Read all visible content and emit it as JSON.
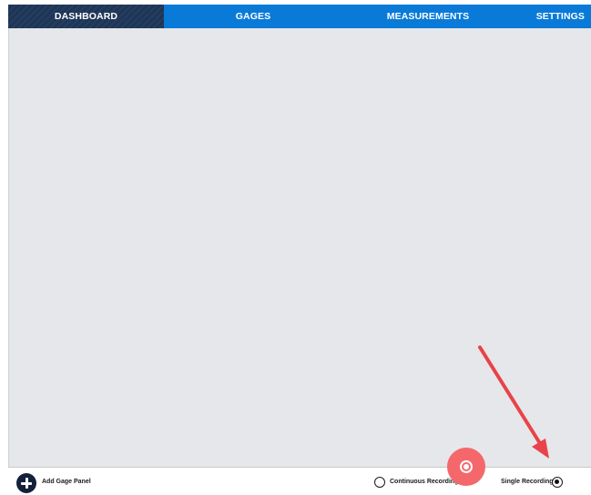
{
  "nav": {
    "tabs": [
      {
        "label": "DASHBOARD",
        "active": true
      },
      {
        "label": "GAGES",
        "active": false
      },
      {
        "label": "MEASUREMENTS",
        "active": false
      },
      {
        "label": "SETTINGS",
        "active": false
      }
    ]
  },
  "bottom_bar": {
    "add_gage_panel_label": "Add Gage Panel",
    "continuous_recording_label": "Continuous Recording",
    "single_recording_label": "Single Recording",
    "selected_mode": "Single Recording"
  },
  "icons": {
    "add": "plus-circle-icon",
    "record": "record-icon",
    "annotation": "arrow-icon"
  },
  "colors": {
    "nav_bar": "#0a7ad8",
    "nav_active": "#1d3557",
    "main_background": "#e6e7ea",
    "record_button": "#f4686c",
    "annotation_arrow": "#e8434a"
  }
}
